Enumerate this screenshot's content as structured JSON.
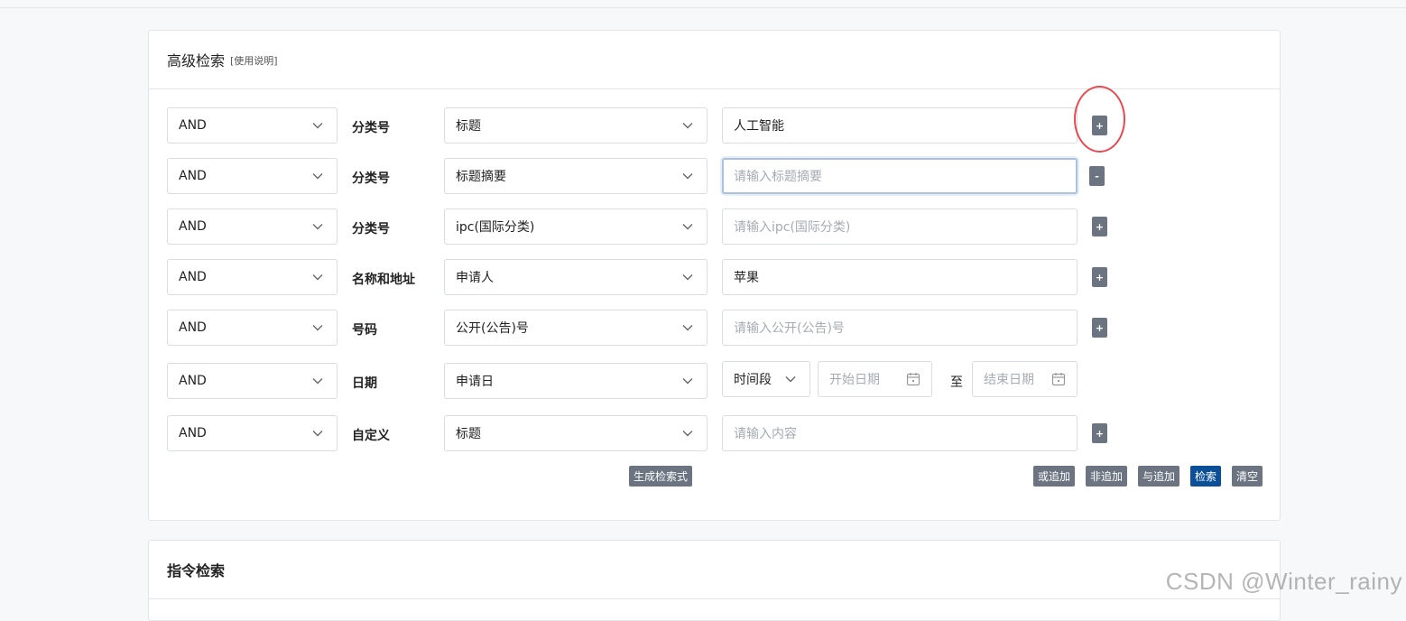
{
  "advanced": {
    "title": "高级检索",
    "help_link": "[使用说明]",
    "rows": [
      {
        "logic": "AND",
        "category": "分类号",
        "field": "标题",
        "value": "人工智能",
        "placeholder": "",
        "button": "+"
      },
      {
        "logic": "AND",
        "category": "分类号",
        "field": "标题摘要",
        "value": "",
        "placeholder": "请输入标题摘要",
        "button": "-"
      },
      {
        "logic": "AND",
        "category": "分类号",
        "field": "ipc(国际分类)",
        "value": "",
        "placeholder": "请输入ipc(国际分类)",
        "button": "+"
      },
      {
        "logic": "AND",
        "category": "名称和地址",
        "field": "申请人",
        "value": "苹果",
        "placeholder": "",
        "button": "+"
      },
      {
        "logic": "AND",
        "category": "号码",
        "field": "公开(公告)号",
        "value": "",
        "placeholder": "请输入公开(公告)号",
        "button": "+"
      },
      {
        "logic": "AND",
        "category": "日期",
        "field": "申请日",
        "value": "",
        "placeholder": "",
        "button": ""
      },
      {
        "logic": "AND",
        "category": "自定义",
        "field": "标题",
        "value": "",
        "placeholder": "请输入内容",
        "button": "+"
      }
    ],
    "date_range": {
      "mode": "时间段",
      "start_placeholder": "开始日期",
      "to_label": "至",
      "end_placeholder": "结束日期"
    },
    "generate_button": "生成检索式",
    "actions": {
      "or_add": "或追加",
      "not_add": "非追加",
      "and_add": "与追加",
      "search": "检索",
      "clear": "清空"
    }
  },
  "command": {
    "title": "指令检索"
  },
  "watermark": "CSDN @Winter_rainy",
  "colors": {
    "accent": "#0a4f97",
    "button_gray": "#6b7480",
    "highlight_circle": "#e8484f"
  }
}
